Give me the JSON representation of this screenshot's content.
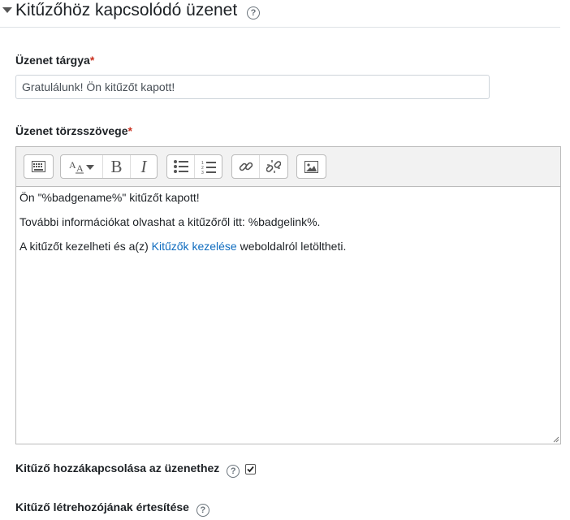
{
  "section": {
    "title": "Kitűzőhöz kapcsolódó üzenet"
  },
  "subject": {
    "label": "Üzenet tárgya",
    "required_marker": "*",
    "value": "Gratulálunk! Ön kitűzőt kapott!"
  },
  "body": {
    "label": "Üzenet törzsszövege",
    "required_marker": "*",
    "line1": "Ön \"%badgename%\" kitűzőt kapott!",
    "line2": "További információkat olvashat a kitűzőről itt: %badgelink%.",
    "line3_before": "A kitűzőt kezelheti és a(z) ",
    "line3_link": "Kitűzők kezelése",
    "line3_after": " weboldalról letöltheti."
  },
  "toolbar": {
    "icons": [
      "toolbar-toggle-icon",
      "font-style-icon",
      "bold-icon",
      "italic-icon",
      "unordered-list-icon",
      "ordered-list-icon",
      "link-icon",
      "unlink-icon",
      "image-icon"
    ],
    "bold_glyph": "B",
    "italic_glyph": "I"
  },
  "attach": {
    "label": "Kitűző hozzákapcsolása az üzenethez",
    "checked": true
  },
  "notify": {
    "label": "Kitűző létrehozójának értesítése"
  },
  "help_glyph": "?"
}
